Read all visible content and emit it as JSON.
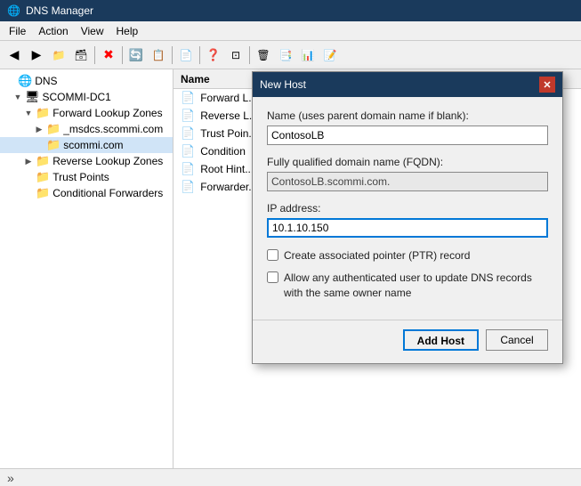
{
  "titleBar": {
    "icon": "🌐",
    "title": "DNS Manager"
  },
  "menuBar": {
    "items": [
      {
        "label": "File",
        "id": "file"
      },
      {
        "label": "Action",
        "id": "action"
      },
      {
        "label": "View",
        "id": "view"
      },
      {
        "label": "Help",
        "id": "help"
      }
    ]
  },
  "toolbar": {
    "buttons": [
      {
        "icon": "◀",
        "label": "back"
      },
      {
        "icon": "▶",
        "label": "forward"
      },
      {
        "icon": "📁",
        "label": "open"
      },
      {
        "icon": "⊞",
        "label": "view"
      },
      {
        "icon": "✖",
        "label": "delete"
      },
      {
        "sep": true
      },
      {
        "icon": "🔄",
        "label": "refresh"
      },
      {
        "icon": "📋",
        "label": "export"
      },
      {
        "sep": true
      },
      {
        "icon": "📄",
        "label": "properties"
      },
      {
        "sep": true
      },
      {
        "icon": "❓",
        "label": "help"
      },
      {
        "icon": "⊡",
        "label": "action1"
      },
      {
        "sep": true
      },
      {
        "icon": "🗑",
        "label": "delete2"
      },
      {
        "icon": "📑",
        "label": "list"
      },
      {
        "icon": "📊",
        "label": "detail"
      },
      {
        "icon": "📝",
        "label": "edit"
      }
    ]
  },
  "tree": {
    "rootLabel": "DNS",
    "nodes": [
      {
        "id": "scommi-dc1",
        "label": "SCOMMI-DC1",
        "indent": 1,
        "expanded": true,
        "icon": "🖥"
      },
      {
        "id": "forward-lookup",
        "label": "Forward Lookup Zones",
        "indent": 2,
        "expanded": true,
        "icon": "📁"
      },
      {
        "id": "_msdcs",
        "label": "_msdcs.scommi.com",
        "indent": 3,
        "expanded": false,
        "icon": "📁"
      },
      {
        "id": "scommi",
        "label": "scommi.com",
        "indent": 3,
        "expanded": false,
        "icon": "📁",
        "selected": true
      },
      {
        "id": "reverse-lookup",
        "label": "Reverse Lookup Zones",
        "indent": 2,
        "expanded": false,
        "icon": "📁"
      },
      {
        "id": "trust-points",
        "label": "Trust Points",
        "indent": 2,
        "expanded": false,
        "icon": "📁"
      },
      {
        "id": "conditional",
        "label": "Conditional Forwarders",
        "indent": 2,
        "expanded": false,
        "icon": "📁"
      }
    ]
  },
  "listPanel": {
    "header": "Name",
    "items": [
      {
        "icon": "📄",
        "label": "Forward L..."
      },
      {
        "icon": "📄",
        "label": "Reverse L..."
      },
      {
        "icon": "📄",
        "label": "Trust Poin..."
      },
      {
        "icon": "📄",
        "label": "Condition"
      },
      {
        "icon": "📄",
        "label": "Root Hint..."
      },
      {
        "icon": "📄",
        "label": "Forwarder..."
      }
    ]
  },
  "statusBar": {
    "arrows": "»",
    "text": ""
  },
  "modal": {
    "title": "New Host",
    "nameLabel": "Name (uses parent domain name if blank):",
    "nameValue": "ContosoLB",
    "fqdnLabel": "Fully qualified domain name (FQDN):",
    "fqdnValue": "ContosoLB.scommi.com.",
    "ipLabel": "IP address:",
    "ipValue": "10.1.10.150",
    "checkbox1Label": "Create associated pointer (PTR) record",
    "checkbox2Label": "Allow any authenticated user to update DNS records with the same owner name",
    "checkbox1Checked": false,
    "checkbox2Checked": false,
    "addHostBtn": "Add Host",
    "cancelBtn": "Cancel"
  }
}
